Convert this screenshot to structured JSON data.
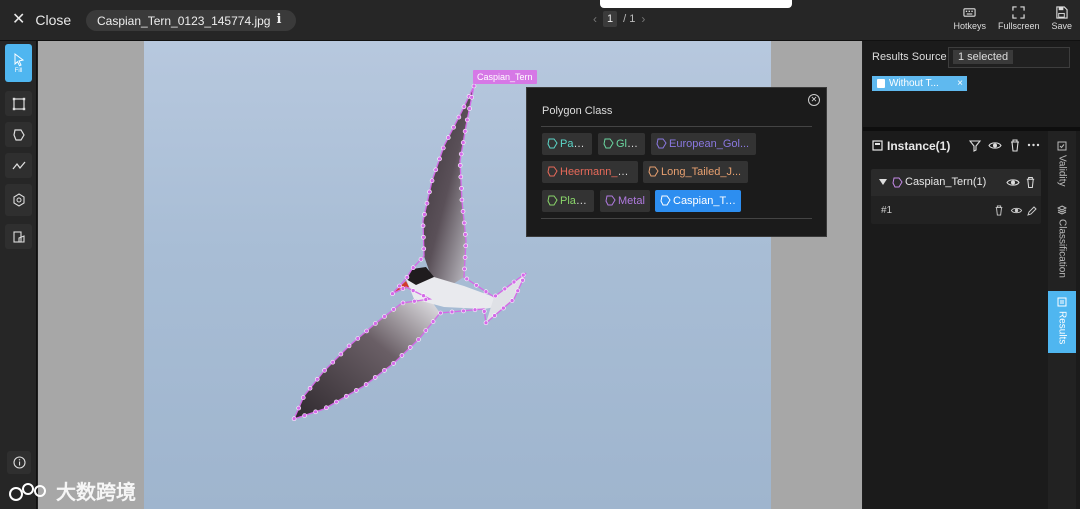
{
  "topbar": {
    "close_label": "Close",
    "filename": "Caspian_Tern_0123_145774.jpg",
    "page_current": "1",
    "page_total": "/ 1",
    "hotkeys_label": "Hotkeys",
    "fullscreen_label": "Fullscreen",
    "save_label": "Save"
  },
  "toolbar": {
    "fill_label": "Fill",
    "tools": [
      "select-tool",
      "rectangle-tool",
      "polygon-tool",
      "polyline-tool",
      "ai-tool",
      "classify-tool"
    ]
  },
  "canvas": {
    "instance_label": "Caspian_Tern",
    "polygon_color": "#d46ae8"
  },
  "popup": {
    "title": "Polygon Class",
    "classes": [
      {
        "label": "Paper",
        "color": "#5bd6c8"
      },
      {
        "label": "Glass",
        "color": "#6ad6a0"
      },
      {
        "label": "European_Gol...",
        "color": "#8a78e0"
      },
      {
        "label": "Heermann_Gull",
        "color": "#e86a5a"
      },
      {
        "label": "Long_Tailed_J...",
        "color": "#e8a070"
      },
      {
        "label": "Plastic",
        "color": "#8ad66a"
      },
      {
        "label": "Metal",
        "color": "#b07ae0"
      },
      {
        "label": "Caspian_Tern",
        "color": "#ffffff",
        "selected": true
      }
    ]
  },
  "rightpanel": {
    "results_source_label": "Results Source",
    "results_source_value": "1 selected",
    "tag_label": "Without T...",
    "instance_title": "Instance(1)",
    "class_row_label": "Caspian_Tern(1)",
    "instance_row_label": "#1",
    "tabs": [
      "Validity",
      "Classification",
      "Results"
    ]
  },
  "watermark": {
    "text": "大数跨境"
  },
  "colors": {
    "accent": "#4fb6f0",
    "selected_chip": "#2d8ef0"
  }
}
